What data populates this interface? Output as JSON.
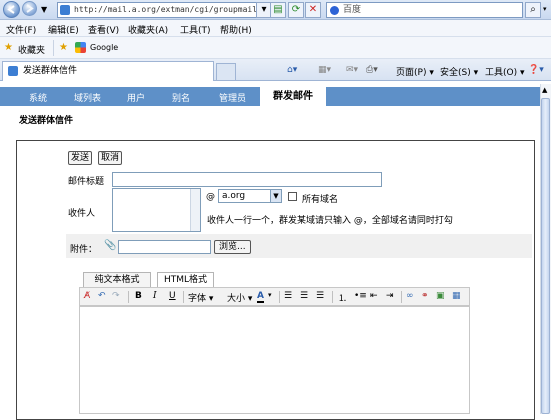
{
  "browser": {
    "url": "http://mail.a.org/extman/cgi/groupmail.cgi",
    "search_placeholder": "百度",
    "menu": [
      "文件(F)",
      "编辑(E)",
      "查看(V)",
      "收藏夹(A)",
      "工具(T)",
      "帮助(H)"
    ],
    "favorites_label": "收藏夹",
    "google_label": "Google",
    "tab_title": "发送群体信件",
    "tools": {
      "page": "页面(P)",
      "safety": "安全(S)",
      "tools": "工具(O)"
    }
  },
  "app_tabs": [
    "系统",
    "域列表",
    "用户",
    "别名",
    "管理员",
    "群发邮件"
  ],
  "page_title": "发送群体信件",
  "form": {
    "send_button": "发送",
    "cancel_button": "取消",
    "subject_label": "邮件标题",
    "subject_value": "",
    "recipients_label": "收件人",
    "at_sign": "@",
    "domain_selected": "a.org",
    "all_domains_label": "所有域名",
    "hint": "收件人一行一个，群发某域请只输入 @，全部域名请同时打勾",
    "attachment_label": "附件：",
    "browse_button": "浏览...",
    "tab_plain": "纯文本格式",
    "tab_html": "HTML格式",
    "font_label": "字体",
    "size_label": "大小"
  }
}
